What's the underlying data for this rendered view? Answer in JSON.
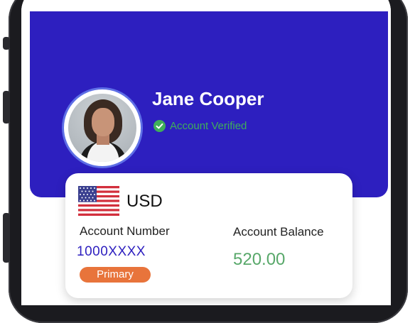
{
  "profile": {
    "name": "Jane Cooper",
    "status": "Account Verified",
    "avatar_icon": "user-photo"
  },
  "account_card": {
    "flag_icon": "us-flag-icon",
    "currency": "USD",
    "account_number_label": "Account Number",
    "account_number": "1000XXXX",
    "badge": "Primary",
    "account_balance_label": "Account Balance",
    "account_balance": "520.00"
  },
  "colors": {
    "header_bg": "#2d1fbf",
    "verified_green": "#3fae5a",
    "account_number_blue": "#2d1fbf",
    "badge_orange": "#e8743b",
    "balance_green": "#58a86a"
  }
}
